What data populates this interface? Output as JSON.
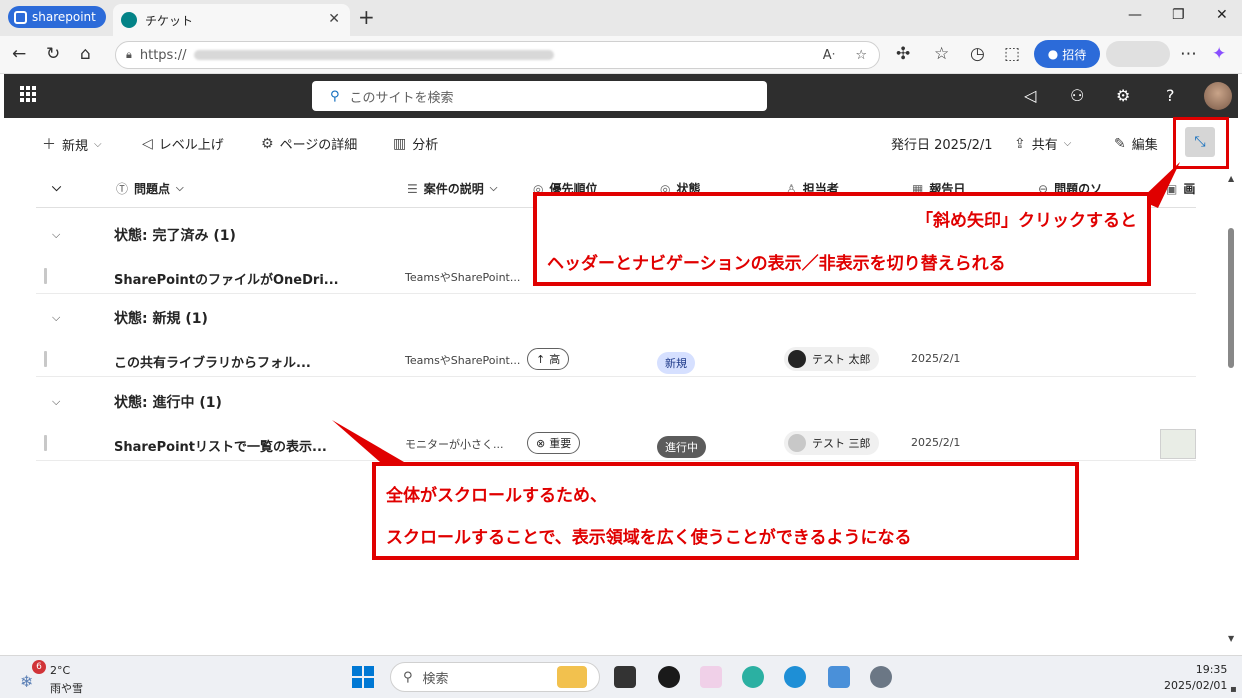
{
  "browser": {
    "profile_label": "sharepoint",
    "tab_title": "チケット",
    "url_prefix": "https://",
    "invite_label": "招待"
  },
  "suite": {
    "search_placeholder": "このサイトを検索"
  },
  "command_bar": {
    "new_label": "新規",
    "promote_label": "レベル上げ",
    "page_details_label": "ページの詳細",
    "analytics_label": "分析",
    "published_label": "発行日 2025/2/1",
    "share_label": "共有",
    "edit_label": "編集"
  },
  "columns": {
    "issue": "問題点",
    "description": "案件の説明",
    "priority": "優先順位",
    "status": "状態",
    "assignee": "担当者",
    "report_date": "報告日",
    "issue_source": "問題のソ",
    "image": "画"
  },
  "groups": [
    {
      "label": "状態: 完了済み (1)"
    },
    {
      "label": "状態: 新規 (1)"
    },
    {
      "label": "状態: 進行中 (1)"
    }
  ],
  "rows": [
    {
      "title": "SharePointのファイルがOneDri...",
      "desc": "TeamsやSharePoint...",
      "priority": "",
      "status": "",
      "assignee": "",
      "date": ""
    },
    {
      "title": "この共有ライブラリからフォル...",
      "desc": "TeamsやSharePoint...",
      "priority": "高",
      "status": "新規",
      "assignee": "テスト 太郎",
      "date": "2025/2/1"
    },
    {
      "title": "SharePointリストで一覧の表示...",
      "desc": "モニターが小さく...",
      "priority": "重要",
      "status": "進行中",
      "assignee": "テスト 三郎",
      "date": "2025/2/1"
    }
  ],
  "callouts": {
    "top_line1": "「斜め矢印」クリックすると",
    "top_line2": "ヘッダーとナビゲーションの表示／非表示を切り替えられる",
    "bottom_line1": "全体がスクロールするため、",
    "bottom_line2": "スクロールすることで、表示領域を広く使うことができるようになる"
  },
  "taskbar": {
    "weather_badge": "6",
    "temperature": "2°C",
    "weather_text": "雨や雪",
    "search_label": "検索",
    "time": "19:35",
    "date": "2025/02/01"
  },
  "colors": {
    "accent": "#0f6cbd",
    "annotation_red": "#e00000",
    "suite_bar": "#2e2e2e",
    "status_new_bg": "#d6e0ff",
    "status_progress_bg": "#5c5c5c"
  }
}
